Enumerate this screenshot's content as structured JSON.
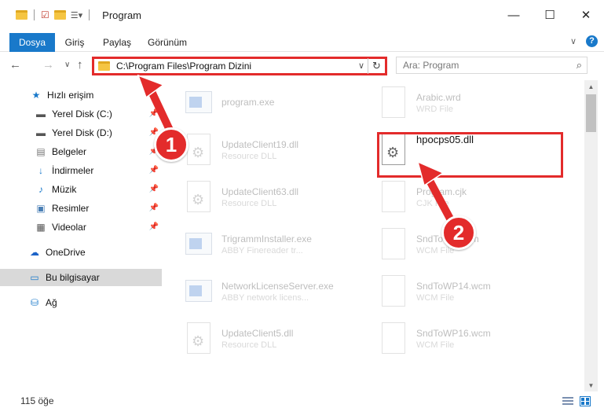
{
  "window": {
    "title": "Program",
    "minimize": "—",
    "maximize": "☐",
    "close": "✕"
  },
  "ribbon": {
    "tabs": [
      {
        "label": "Dosya",
        "active": true
      },
      {
        "label": "Giriş",
        "active": false
      },
      {
        "label": "Paylaş",
        "active": false
      },
      {
        "label": "Görünüm",
        "active": false
      }
    ],
    "expand": "∨",
    "help": "?"
  },
  "nav": {
    "back": "←",
    "forward": "→",
    "recent": "∨",
    "up": "↑",
    "address": "C:\\Program Files\\Program Dizini",
    "address_dropdown": "∨",
    "refresh": "↻"
  },
  "search": {
    "placeholder": "Ara: Program",
    "icon": "⌕"
  },
  "sidebar": {
    "items": [
      {
        "label": "Hızlı erişim",
        "icon": "★",
        "icon_name": "star-icon",
        "pinned": false
      },
      {
        "label": "Yerel Disk (C:)",
        "icon": "▬",
        "icon_name": "drive-icon",
        "pinned": true
      },
      {
        "label": "Yerel Disk (D:)",
        "icon": "▬",
        "icon_name": "drive-icon",
        "pinned": true
      },
      {
        "label": "Belgeler",
        "icon": "▤",
        "icon_name": "documents-icon",
        "pinned": true
      },
      {
        "label": "İndirmeler",
        "icon": "↓",
        "icon_name": "downloads-icon",
        "pinned": true
      },
      {
        "label": "Müzik",
        "icon": "♪",
        "icon_name": "music-icon",
        "pinned": true
      },
      {
        "label": "Resimler",
        "icon": "▣",
        "icon_name": "pictures-icon",
        "pinned": true
      },
      {
        "label": "Videolar",
        "icon": "▦",
        "icon_name": "videos-icon",
        "pinned": true
      },
      {
        "label": "OneDrive",
        "icon": "☁",
        "icon_name": "cloud-icon",
        "pinned": false
      },
      {
        "label": "Bu bilgisayar",
        "icon": "▭",
        "icon_name": "computer-icon",
        "pinned": false,
        "selected": true
      },
      {
        "label": "Ağ",
        "icon": "⛁",
        "icon_name": "network-icon",
        "pinned": false
      }
    ],
    "pin_glyph": "📌"
  },
  "files": {
    "left": [
      {
        "name": "program.exe",
        "sub": "",
        "kind": "exe"
      },
      {
        "name": "UpdateClient19.dll",
        "sub": "Resource DLL",
        "kind": "dll"
      },
      {
        "name": "UpdateClient63.dll",
        "sub": "Resource DLL",
        "kind": "dll"
      },
      {
        "name": "TrigrammInstaller.exe",
        "sub": "ABBY Finereader tr...",
        "kind": "exe"
      },
      {
        "name": "NetworkLicenseServer.exe",
        "sub": "ABBY network licens...",
        "kind": "exe"
      },
      {
        "name": "UpdateClient5.dll",
        "sub": "Resource DLL",
        "kind": "dll"
      }
    ],
    "right": [
      {
        "name": "Arabic.wrd",
        "sub": "WRD File",
        "kind": "file"
      },
      {
        "name": "hpocps05.dll",
        "sub": "",
        "kind": "dll",
        "highlighted": true
      },
      {
        "name": "Program.cjk",
        "sub": "CJK File",
        "kind": "file"
      },
      {
        "name": "SndToWP.wcm",
        "sub": "WCM File",
        "kind": "file"
      },
      {
        "name": "SndToWP14.wcm",
        "sub": "WCM File",
        "kind": "file"
      },
      {
        "name": "SndToWP16.wcm",
        "sub": "WCM File",
        "kind": "file"
      }
    ]
  },
  "annotations": {
    "badge1": "1",
    "badge2": "2",
    "accent_color": "#e32b2b"
  },
  "status": {
    "count": "115 öğe"
  }
}
